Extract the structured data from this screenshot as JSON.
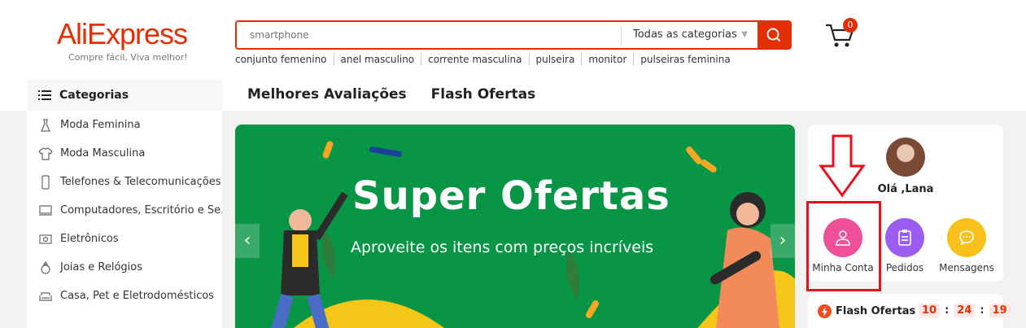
{
  "logo": {
    "text": "AliExpress",
    "tagline": "Compre fácil, Viva melhor!"
  },
  "search": {
    "placeholder": "smartphone",
    "category": "Todas as categorias"
  },
  "suggestions": [
    "conjunto femenino",
    "anel masculino",
    "corrente masculina",
    "pulseira",
    "monitor",
    "pulseiras feminina"
  ],
  "cart": {
    "count": "0"
  },
  "categories": {
    "title": "Categorias",
    "items": [
      {
        "label": "Moda Feminina",
        "icon": "dress-icon"
      },
      {
        "label": "Moda Masculina",
        "icon": "shirt-icon"
      },
      {
        "label": "Telefones & Telecomunicações",
        "icon": "phone-icon"
      },
      {
        "label": "Computadores, Escritório e Se...",
        "icon": "computer-icon"
      },
      {
        "label": "Eletrônicos",
        "icon": "camera-icon"
      },
      {
        "label": "Joias e Relógios",
        "icon": "ring-icon"
      },
      {
        "label": "Casa, Pet e Eletrodomésticos",
        "icon": "sofa-icon"
      }
    ]
  },
  "tabs": [
    "Melhores Avaliações",
    "Flash Ofertas"
  ],
  "banner": {
    "title": "Super Ofertas",
    "subtitle": "Aproveite os itens com preços incríveis",
    "bg": "#099546"
  },
  "account": {
    "greeting": "Olá ,Lana",
    "buttons": [
      {
        "label": "Minha Conta",
        "icon": "user-icon",
        "color": "#f0509a"
      },
      {
        "label": "Pedidos",
        "icon": "clipboard-icon",
        "color": "#9b5cf0"
      },
      {
        "label": "Mensagens",
        "icon": "chat-icon",
        "color": "#f7c01a"
      }
    ]
  },
  "flash": {
    "title": "Flash Ofertas",
    "hours": "10",
    "minutes": "24",
    "seconds": "19"
  },
  "colors": {
    "brand": "#e62e04",
    "annotation": "#e8101a"
  }
}
